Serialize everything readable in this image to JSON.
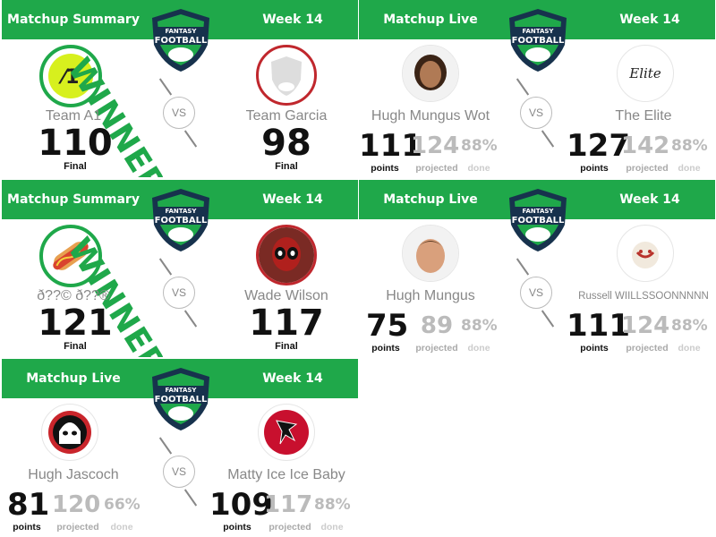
{
  "colors": {
    "green": "#1fa84a",
    "winner": "#1fa84a",
    "muted": "#bbbbbb"
  },
  "logo_text": "FANTASY FOOTBALL",
  "vs_label": "VS",
  "winner_label": "WINNER",
  "labels": {
    "final": "Final",
    "points": "points",
    "projected": "projected",
    "done": "done"
  },
  "cards": [
    {
      "type": "summary",
      "header_left": "Matchup Summary",
      "header_right": "Week 14",
      "left": {
        "name": "Team A1",
        "score": "110",
        "avatar": "a1-logo-icon"
      },
      "right": {
        "name": "Team Garcia",
        "score": "98",
        "avatar": "fantasy-football-logo-icon"
      }
    },
    {
      "type": "live",
      "header_left": "Matchup Live",
      "header_right": "Week 14",
      "left": {
        "name": "Hugh Mungus Wot",
        "points": "111",
        "projected": "124",
        "done": "88%",
        "avatar": "woman-photo-icon"
      },
      "right": {
        "name": "The Elite",
        "points": "127",
        "projected": "142",
        "done": "88%",
        "avatar": "elite-script-icon"
      }
    },
    {
      "type": "summary",
      "header_left": "Matchup Summary",
      "header_right": "Week 14",
      "left": {
        "name": "ð??© ð??®",
        "score": "121",
        "avatar": "hotdog-icon"
      },
      "right": {
        "name": "Wade Wilson",
        "score": "117",
        "avatar": "deadpool-icon"
      }
    },
    {
      "type": "live",
      "header_left": "Matchup Live",
      "header_right": "Week 14",
      "left": {
        "name": "Hugh Mungus",
        "points": "75",
        "projected": "89",
        "done": "88%",
        "avatar": "man-photo-icon"
      },
      "right": {
        "name": "Russell WIILLSSOONNNNN",
        "points": "111",
        "projected": "124",
        "done": "88%",
        "avatar": "volleyball-icon"
      }
    },
    {
      "type": "live",
      "header_left": "Matchup Live",
      "header_right": "Week 14",
      "left": {
        "name": "Hugh Jascoch",
        "points": "81",
        "projected": "120",
        "done": "66%",
        "avatar": "stormtrooper-icon"
      },
      "right": {
        "name": "Matty Ice Ice Baby",
        "points": "109",
        "projected": "117",
        "done": "88%",
        "avatar": "falcons-icon"
      }
    }
  ]
}
